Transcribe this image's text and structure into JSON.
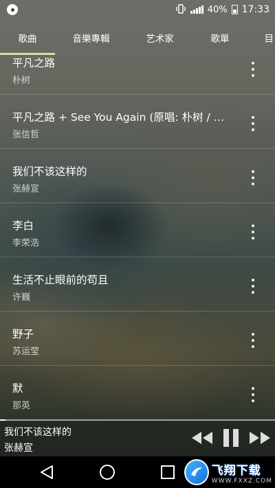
{
  "status_bar": {
    "battery": "40%",
    "time": "17:33",
    "icons": [
      "music-disc-icon",
      "vibrate-icon",
      "signal-icon",
      "battery-icon"
    ]
  },
  "tabs": [
    {
      "label": "歌曲",
      "active": true
    },
    {
      "label": "音樂專輯",
      "active": false
    },
    {
      "label": "艺术家",
      "active": false
    },
    {
      "label": "歌單",
      "active": false
    },
    {
      "label": "目",
      "active": false
    }
  ],
  "accent_color": "#c8e6a0",
  "songs": [
    {
      "title": "平凡之路",
      "artist": "朴树"
    },
    {
      "title": "平凡之路 + See You Again (原唱: 朴树 / Wiz Khalifa)",
      "artist": "张信哲"
    },
    {
      "title": "我们不该这样的",
      "artist": "张赫宣"
    },
    {
      "title": "李白",
      "artist": "李荣浩"
    },
    {
      "title": "生活不止眼前的苟且",
      "artist": "许巍"
    },
    {
      "title": "野子",
      "artist": "苏运莹"
    },
    {
      "title": "默",
      "artist": "那英"
    }
  ],
  "now_playing": {
    "title": "我们不该这样的",
    "artist": "张赫宣",
    "progress": 0.02
  },
  "controls": [
    "rewind-icon",
    "pause-icon",
    "fast-forward-icon"
  ],
  "nav": [
    "back-icon",
    "home-icon",
    "recents-icon"
  ],
  "watermark": {
    "main": "飞翔下载",
    "sub": "WWW.FXXZ.COM"
  }
}
